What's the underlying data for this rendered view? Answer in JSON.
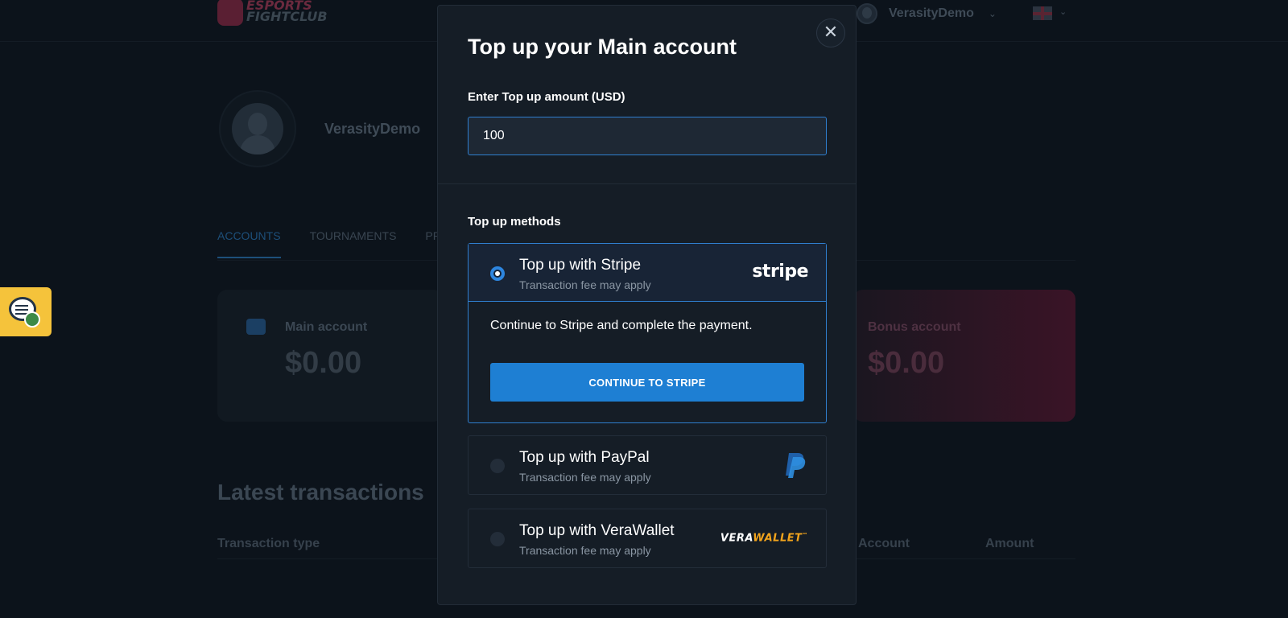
{
  "header": {
    "logo_line1": "ESPORTS",
    "logo_line2": "FIGHTCLUB",
    "username": "VerasityDemo"
  },
  "profile": {
    "username": "VerasityDemo"
  },
  "tabs": [
    {
      "label": "ACCOUNTS",
      "active": true
    },
    {
      "label": "TOURNAMENTS",
      "active": false
    },
    {
      "label": "PR",
      "active": false
    }
  ],
  "accounts": {
    "main": {
      "label": "Main account",
      "amount": "$0.00"
    },
    "bonus": {
      "label": "Bonus account",
      "amount": "$0.00"
    }
  },
  "transactions": {
    "title": "Latest transactions",
    "columns": [
      "Transaction type",
      "Account",
      "Amount"
    ]
  },
  "modal": {
    "title": "Top up your Main account",
    "amount_label": "Enter Top up amount (USD)",
    "amount_value": "100",
    "methods_label": "Top up methods",
    "methods": [
      {
        "title": "Top up with Stripe",
        "subtitle": "Transaction fee may apply",
        "brand": "stripe",
        "selected": true,
        "description": "Continue to Stripe and complete the payment.",
        "button": "CONTINUE TO STRIPE"
      },
      {
        "title": "Top up with PayPal",
        "subtitle": "Transaction fee may apply",
        "brand": "paypal",
        "selected": false
      },
      {
        "title": "Top up with VeraWallet",
        "subtitle": "Transaction fee may apply",
        "brand_part1": "VERA",
        "brand_part2": "WALLET",
        "brand_tm": "™",
        "selected": false
      }
    ]
  },
  "colors": {
    "accent": "#1e7fd3",
    "modal_bg": "#151d26",
    "page_bg": "#0c131b",
    "chat_widget": "#f5c33b",
    "verawallet_orange": "#f2a41c"
  },
  "icons": [
    "close-icon",
    "radio-icon",
    "wallet-icon",
    "avatar-icon",
    "chat-support-icon",
    "uk-flag-icon",
    "chevron-down-icon",
    "paypal-logo-icon"
  ]
}
